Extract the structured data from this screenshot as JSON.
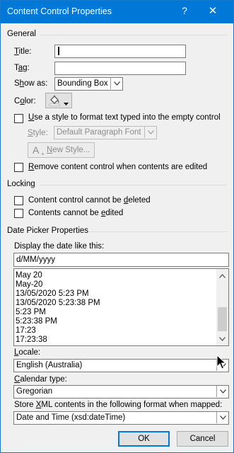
{
  "window": {
    "title": "Content Control Properties",
    "help_glyph": "?",
    "close_glyph": "✕"
  },
  "general": {
    "heading": "General",
    "title_label_u": "T",
    "title_label_rest": "itle:",
    "tag_label_pre": "T",
    "tag_label_u": "a",
    "tag_label_rest": "g:",
    "show_as_label_pre": "S",
    "show_as_label_u": "h",
    "show_as_label_rest": "ow as:",
    "show_as_value": "Bounding Box",
    "color_label_pre": "C",
    "color_label_u": "o",
    "color_label_rest": "lor:",
    "use_style_u": "U",
    "use_style_rest": "se a style to format text typed into the empty control",
    "style_label_u": "S",
    "style_label_rest": "tyle:",
    "style_value": "Default Paragraph Font",
    "new_style_pre": "A",
    "new_style_u": "N",
    "new_style_rest": "ew Style...",
    "remove_pre": "",
    "remove_u": "R",
    "remove_rest": "emove content control when contents are edited"
  },
  "locking": {
    "heading": "Locking",
    "cannot_delete_pre": "Content control cannot be ",
    "cannot_delete_u": "d",
    "cannot_delete_rest": "eleted",
    "cannot_edit_pre": "Contents cannot be ",
    "cannot_edit_u": "e",
    "cannot_edit_rest": "dited"
  },
  "date_picker": {
    "heading": "Date Picker Properties",
    "display_label_pre": "Display the date like this:",
    "format_value": "d/MM/yyyy",
    "formats": [
      "May 20",
      "May-20",
      "13/05/2020 5:23 PM",
      "13/05/2020 5:23:38 PM",
      "5:23 PM",
      "5:23:38 PM",
      "17:23",
      "17:23:38"
    ],
    "locale_label_pre": "",
    "locale_label_u": "L",
    "locale_label_rest": "ocale:",
    "locale_value": "English (Australia)",
    "calendar_label_pre": "",
    "calendar_label_u": "C",
    "calendar_label_rest": "alendar type:",
    "calendar_value": "Gregorian",
    "xml_label_pre": "Store ",
    "xml_label_u": "X",
    "xml_label_rest": "ML contents in the following format when mapped:",
    "xml_value": "Date and Time (xsd:dateTime)"
  },
  "footer": {
    "ok_label": "OK",
    "cancel_label": "Cancel"
  }
}
